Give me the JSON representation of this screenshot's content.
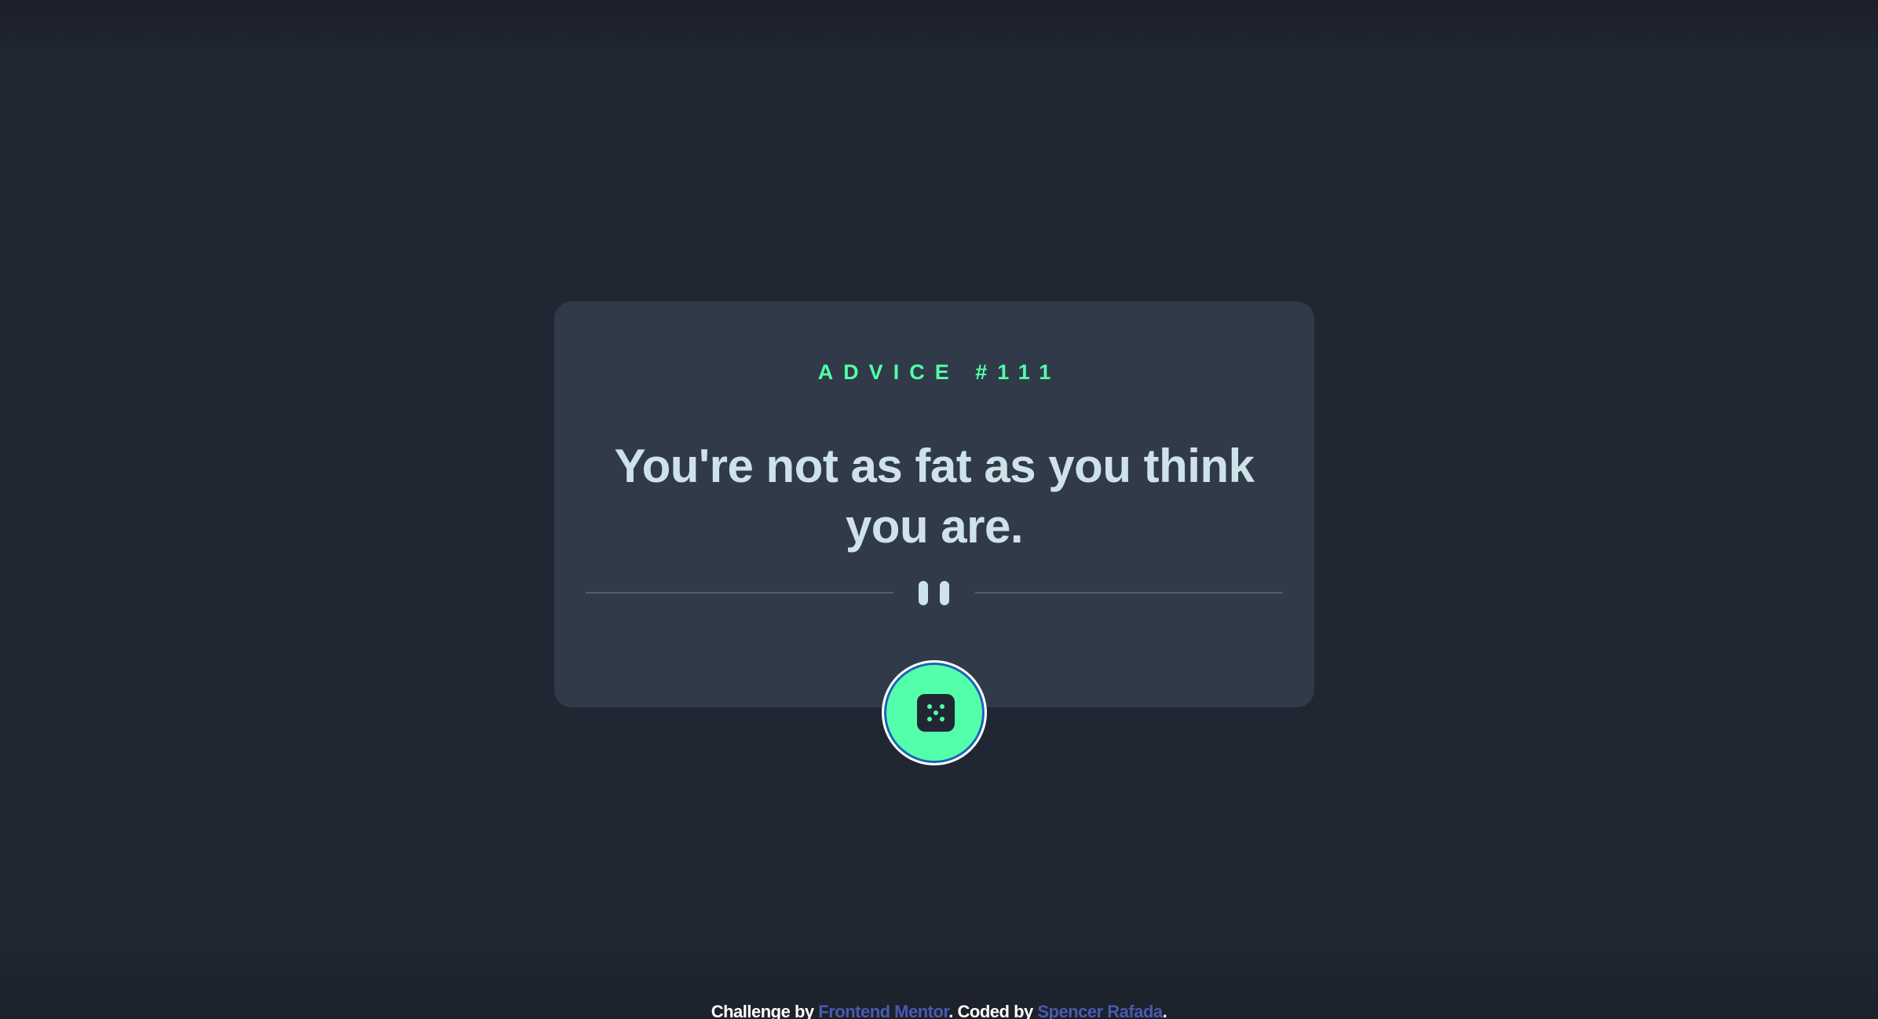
{
  "card": {
    "advice_label": "ADVICE #111",
    "quote": "You're not as fat as you think you are."
  },
  "divider": {
    "icon": "pause-icon"
  },
  "button": {
    "icon": "dice-icon"
  },
  "footer": {
    "prefix": "Challenge by ",
    "link1": "Frontend Mentor",
    "middle": ". Coded by ",
    "link2": "Spencer Rafada",
    "suffix": "."
  },
  "colors": {
    "background": "#202733",
    "card": "#313a48",
    "accent": "#53ffaa",
    "text": "#cee3e9",
    "divider": "#4f5d74",
    "link": "#4a5ab0"
  }
}
